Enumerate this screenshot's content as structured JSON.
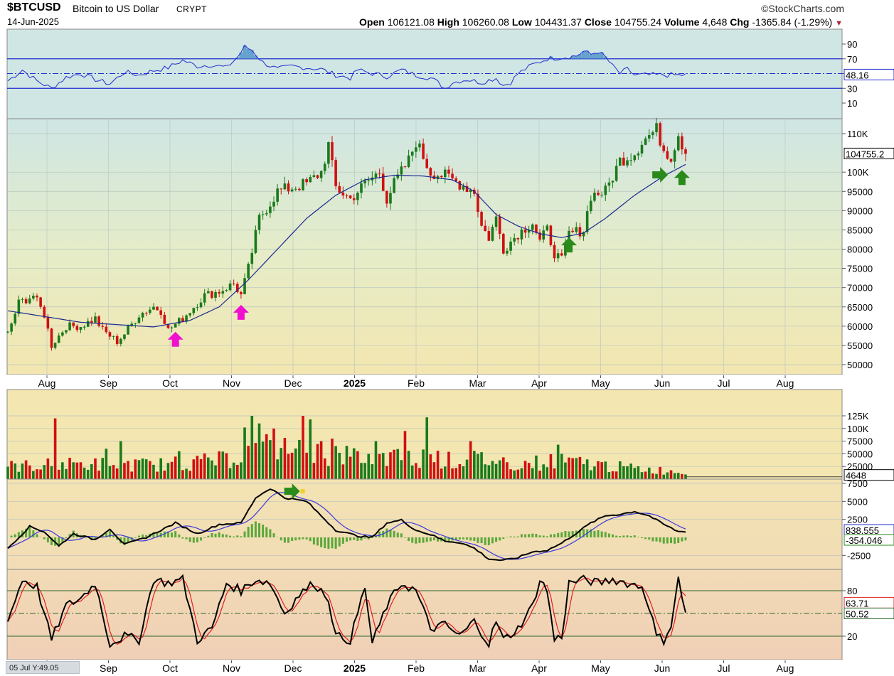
{
  "header": {
    "symbol": "$BTCUSD",
    "description": "Bitcoin to US Dollar",
    "exchange": "CRYPT",
    "date": "14-Jun-2025",
    "brand": "StockCharts.com",
    "open_label": "Open",
    "open": "106121.08",
    "high_label": "High",
    "high": "106260.08",
    "low_label": "Low",
    "low": "104431.37",
    "close_label": "Close",
    "close": "104755.24",
    "volume_label": "Volume",
    "volume": "4,648",
    "chg_label": "Chg",
    "chg": "-1365.84 (-1.29%)"
  },
  "cursor_readout": "05 Jul Y:49.05",
  "chart_data": [
    {
      "panel": "rsi",
      "type": "line",
      "y_ticks": [
        "90",
        "70",
        "50",
        "30",
        "10"
      ],
      "bands": [
        70,
        30
      ],
      "mid": 50,
      "ylim": [
        0,
        100
      ],
      "last_label": "48.16",
      "colors": {
        "line": "#1f2bd0",
        "fill": "#4a90c8",
        "bg": "#cfe6e4"
      },
      "knots": [
        [
          0,
          40
        ],
        [
          4,
          55
        ],
        [
          8,
          40
        ],
        [
          12,
          30
        ],
        [
          16,
          45
        ],
        [
          20,
          50
        ],
        [
          24,
          42
        ],
        [
          28,
          36
        ],
        [
          32,
          52
        ],
        [
          36,
          48
        ],
        [
          40,
          54
        ],
        [
          44,
          58
        ],
        [
          48,
          68
        ],
        [
          52,
          60
        ],
        [
          56,
          62
        ],
        [
          60,
          58
        ],
        [
          63,
          72
        ],
        [
          65,
          86
        ],
        [
          67,
          82
        ],
        [
          70,
          65
        ],
        [
          74,
          56
        ],
        [
          78,
          60
        ],
        [
          82,
          58
        ],
        [
          86,
          56
        ],
        [
          90,
          48
        ],
        [
          94,
          44
        ],
        [
          96,
          55
        ],
        [
          100,
          50
        ],
        [
          104,
          46
        ],
        [
          108,
          55
        ],
        [
          112,
          48
        ],
        [
          116,
          44
        ],
        [
          118,
          38
        ],
        [
          120,
          30
        ],
        [
          122,
          38
        ],
        [
          126,
          42
        ],
        [
          130,
          38
        ],
        [
          134,
          44
        ],
        [
          136,
          34
        ],
        [
          138,
          38
        ],
        [
          140,
          50
        ],
        [
          144,
          62
        ],
        [
          148,
          70
        ],
        [
          152,
          72
        ],
        [
          156,
          74
        ],
        [
          158,
          80
        ],
        [
          160,
          76
        ],
        [
          162,
          80
        ],
        [
          164,
          72
        ],
        [
          166,
          60
        ],
        [
          168,
          50
        ],
        [
          170,
          56
        ],
        [
          172,
          48
        ]
      ]
    },
    {
      "panel": "price",
      "type": "candlestick",
      "x_axis": {
        "labels": [
          "Aug",
          "Sep",
          "Oct",
          "Nov",
          "Dec",
          "2025",
          "Feb",
          "Mar",
          "Apr",
          "May",
          "Jun",
          "Jul",
          "Aug"
        ],
        "bold": "2025"
      },
      "y_ticks": [
        {
          "v": 110000,
          "label": "110K"
        },
        {
          "v": 100000,
          "label": "100K"
        },
        {
          "v": 95000,
          "label": "95000"
        },
        {
          "v": 90000,
          "label": "90000"
        },
        {
          "v": 85000,
          "label": "85000"
        },
        {
          "v": 80000,
          "label": "80000"
        },
        {
          "v": 75000,
          "label": "75000"
        },
        {
          "v": 70000,
          "label": "70000"
        },
        {
          "v": 65000,
          "label": "65000"
        },
        {
          "v": 60000,
          "label": "60000"
        },
        {
          "v": 55000,
          "label": "55000"
        },
        {
          "v": 50000,
          "label": "50000"
        }
      ],
      "ylim": [
        48000,
        116000
      ],
      "last_label": "104755.2",
      "colors": {
        "up": "#1a7a1a",
        "down": "#d01010",
        "ma": "#1a2890",
        "bg_top": "#cfe6e4",
        "bg_bottom": "#f3e6b0"
      },
      "close_knots": [
        [
          0,
          58000
        ],
        [
          3,
          66000
        ],
        [
          7,
          68000
        ],
        [
          10,
          63000
        ],
        [
          12,
          55000
        ],
        [
          16,
          60000
        ],
        [
          20,
          60000
        ],
        [
          24,
          62000
        ],
        [
          26,
          59000
        ],
        [
          30,
          56000
        ],
        [
          32,
          58000
        ],
        [
          36,
          63000
        ],
        [
          40,
          65000
        ],
        [
          42,
          64000
        ],
        [
          44,
          59000
        ],
        [
          48,
          62000
        ],
        [
          50,
          64000
        ],
        [
          54,
          68000
        ],
        [
          58,
          69000
        ],
        [
          62,
          71000
        ],
        [
          64,
          68000
        ],
        [
          66,
          75000
        ],
        [
          69,
          88000
        ],
        [
          72,
          92000
        ],
        [
          74,
          95000
        ],
        [
          78,
          96000
        ],
        [
          82,
          97000
        ],
        [
          86,
          100000
        ],
        [
          88,
          107000
        ],
        [
          90,
          96000
        ],
        [
          94,
          93000
        ],
        [
          98,
          97000
        ],
        [
          102,
          100000
        ],
        [
          104,
          93000
        ],
        [
          106,
          97000
        ],
        [
          110,
          103000
        ],
        [
          112,
          108000
        ],
        [
          114,
          104000
        ],
        [
          116,
          100000
        ],
        [
          120,
          99000
        ],
        [
          124,
          97000
        ],
        [
          128,
          95000
        ],
        [
          130,
          86000
        ],
        [
          132,
          83000
        ],
        [
          134,
          88000
        ],
        [
          136,
          80000
        ],
        [
          140,
          84000
        ],
        [
          144,
          87000
        ],
        [
          146,
          82000
        ],
        [
          148,
          85000
        ],
        [
          150,
          79000
        ],
        [
          152,
          77000
        ],
        [
          154,
          84000
        ],
        [
          158,
          85000
        ],
        [
          160,
          94000
        ],
        [
          164,
          95000
        ],
        [
          168,
          103000
        ],
        [
          172,
          105000
        ],
        [
          174,
          108000
        ],
        [
          178,
          111000
        ],
        [
          180,
          106000
        ],
        [
          182,
          104000
        ],
        [
          184,
          110000
        ],
        [
          186,
          104755
        ]
      ],
      "ma_knots": [
        [
          0,
          64000
        ],
        [
          20,
          61000
        ],
        [
          40,
          59800
        ],
        [
          50,
          61500
        ],
        [
          58,
          65000
        ],
        [
          66,
          72000
        ],
        [
          74,
          80000
        ],
        [
          82,
          88000
        ],
        [
          90,
          94000
        ],
        [
          98,
          98000
        ],
        [
          106,
          99200
        ],
        [
          114,
          99000
        ],
        [
          122,
          98000
        ],
        [
          128,
          95000
        ],
        [
          134,
          89000
        ],
        [
          140,
          86000
        ],
        [
          146,
          84000
        ],
        [
          152,
          83000
        ],
        [
          158,
          84200
        ],
        [
          164,
          88000
        ],
        [
          172,
          94000
        ],
        [
          180,
          99000
        ],
        [
          186,
          102000
        ]
      ],
      "markers": [
        {
          "kind": "up-arrow",
          "color": "#f010d0",
          "i": 46,
          "v": 56500
        },
        {
          "kind": "up-arrow",
          "color": "#f010d0",
          "i": 64,
          "v": 63500
        },
        {
          "kind": "up-arrow",
          "color": "#2a8a1a",
          "i": 154,
          "v": 81000
        },
        {
          "kind": "right-arrow",
          "color": "#2a8a1a",
          "i": 179,
          "v": 99300
        },
        {
          "kind": "up-arrow",
          "color": "#2a8a1a",
          "i": 185,
          "v": 98500
        }
      ]
    },
    {
      "panel": "volume",
      "type": "bar",
      "y_ticks": [
        {
          "v": 125000,
          "label": "125K"
        },
        {
          "v": 100000,
          "label": "100K"
        },
        {
          "v": 75000,
          "label": "75000"
        },
        {
          "v": 50000,
          "label": "50000"
        },
        {
          "v": 25000,
          "label": "25000"
        }
      ],
      "ylim": [
        0,
        135000
      ],
      "last_label": "4648",
      "colors": {
        "up": "#1a7a1a",
        "down": "#d01010",
        "bg": "#f3e6b0"
      },
      "knots": [
        [
          0,
          25000
        ],
        [
          20,
          30000
        ],
        [
          40,
          28000
        ],
        [
          50,
          32000
        ],
        [
          60,
          38000
        ],
        [
          66,
          55000
        ],
        [
          72,
          62000
        ],
        [
          80,
          55000
        ],
        [
          90,
          50000
        ],
        [
          100,
          40000
        ],
        [
          110,
          42000
        ],
        [
          116,
          45000
        ],
        [
          122,
          35000
        ],
        [
          130,
          40000
        ],
        [
          140,
          30000
        ],
        [
          150,
          35000
        ],
        [
          160,
          30000
        ],
        [
          170,
          22000
        ],
        [
          186,
          14000
        ]
      ],
      "spikes": [
        [
          13,
          120000
        ],
        [
          27,
          60000
        ],
        [
          31,
          75000
        ],
        [
          47,
          55000
        ],
        [
          65,
          102000
        ],
        [
          67,
          125000
        ],
        [
          69,
          110000
        ],
        [
          73,
          100000
        ],
        [
          81,
          125000
        ],
        [
          83,
          118000
        ],
        [
          89,
          80000
        ],
        [
          101,
          75000
        ],
        [
          109,
          95000
        ],
        [
          115,
          122000
        ],
        [
          127,
          75000
        ],
        [
          151,
          68000
        ]
      ]
    },
    {
      "panel": "macd",
      "type": "line",
      "y_ticks": [
        {
          "v": 7500,
          "label": "7500"
        },
        {
          "v": 5000,
          "label": "5000"
        },
        {
          "v": 2500,
          "label": "2500"
        },
        {
          "v": -2500,
          "label": "-2500"
        }
      ],
      "ylim": [
        -4000,
        8000
      ],
      "labels": [
        "838.555",
        "-354.046"
      ],
      "colors": {
        "macd": "#000000",
        "signal": "#3a3adc",
        "hist": "#5aa83a",
        "bg": "#f3e0b0"
      },
      "knots": [
        [
          0,
          -1500
        ],
        [
          6,
          1500
        ],
        [
          10,
          800
        ],
        [
          14,
          -1200
        ],
        [
          18,
          500
        ],
        [
          24,
          -300
        ],
        [
          28,
          1200
        ],
        [
          32,
          -1000
        ],
        [
          38,
          0
        ],
        [
          42,
          1000
        ],
        [
          46,
          2000
        ],
        [
          52,
          500
        ],
        [
          58,
          1800
        ],
        [
          64,
          2000
        ],
        [
          68,
          5500
        ],
        [
          72,
          6800
        ],
        [
          76,
          5500
        ],
        [
          82,
          5000
        ],
        [
          86,
          3000
        ],
        [
          90,
          1000
        ],
        [
          96,
          200
        ],
        [
          100,
          0
        ],
        [
          104,
          2000
        ],
        [
          108,
          2400
        ],
        [
          112,
          1000
        ],
        [
          116,
          400
        ],
        [
          120,
          -500
        ],
        [
          124,
          -700
        ],
        [
          128,
          -1500
        ],
        [
          132,
          -3000
        ],
        [
          136,
          -3200
        ],
        [
          140,
          -2800
        ],
        [
          144,
          -2000
        ],
        [
          148,
          -1800
        ],
        [
          152,
          -800
        ],
        [
          156,
          600
        ],
        [
          160,
          2000
        ],
        [
          164,
          3000
        ],
        [
          168,
          3200
        ],
        [
          172,
          3600
        ],
        [
          176,
          3000
        ],
        [
          180,
          1800
        ],
        [
          184,
          800
        ],
        [
          186,
          838
        ]
      ],
      "arrow": {
        "kind": "right-arrow",
        "color": "#2a8a1a",
        "i": 78,
        "v": 6400
      }
    },
    {
      "panel": "stochastic",
      "type": "line",
      "y_ticks": [
        {
          "v": 80,
          "label": "80"
        },
        {
          "v": 20,
          "label": "20"
        }
      ],
      "ylim": [
        0,
        105
      ],
      "bands": [
        80,
        20
      ],
      "mid": 50,
      "labels": [
        "63.71",
        "50.52"
      ],
      "colors": {
        "k": "#000000",
        "d": "#e02020",
        "bg": "#f3d9b8"
      },
      "knots": [
        [
          0,
          40
        ],
        [
          4,
          95
        ],
        [
          8,
          85
        ],
        [
          12,
          15
        ],
        [
          16,
          60
        ],
        [
          20,
          70
        ],
        [
          24,
          90
        ],
        [
          28,
          10
        ],
        [
          32,
          20
        ],
        [
          36,
          15
        ],
        [
          40,
          95
        ],
        [
          44,
          90
        ],
        [
          48,
          95
        ],
        [
          52,
          15
        ],
        [
          56,
          30
        ],
        [
          60,
          90
        ],
        [
          64,
          80
        ],
        [
          68,
          95
        ],
        [
          72,
          90
        ],
        [
          76,
          50
        ],
        [
          80,
          75
        ],
        [
          84,
          90
        ],
        [
          88,
          70
        ],
        [
          90,
          20
        ],
        [
          94,
          15
        ],
        [
          98,
          85
        ],
        [
          100,
          10
        ],
        [
          104,
          60
        ],
        [
          108,
          90
        ],
        [
          112,
          80
        ],
        [
          116,
          30
        ],
        [
          120,
          35
        ],
        [
          124,
          20
        ],
        [
          128,
          40
        ],
        [
          132,
          10
        ],
        [
          134,
          40
        ],
        [
          136,
          15
        ],
        [
          140,
          30
        ],
        [
          144,
          60
        ],
        [
          146,
          95
        ],
        [
          148,
          80
        ],
        [
          150,
          15
        ],
        [
          152,
          20
        ],
        [
          154,
          90
        ],
        [
          158,
          95
        ],
        [
          162,
          90
        ],
        [
          166,
          95
        ],
        [
          170,
          90
        ],
        [
          174,
          85
        ],
        [
          176,
          60
        ],
        [
          178,
          20
        ],
        [
          180,
          15
        ],
        [
          182,
          35
        ],
        [
          184,
          95
        ],
        [
          186,
          50
        ]
      ]
    }
  ]
}
